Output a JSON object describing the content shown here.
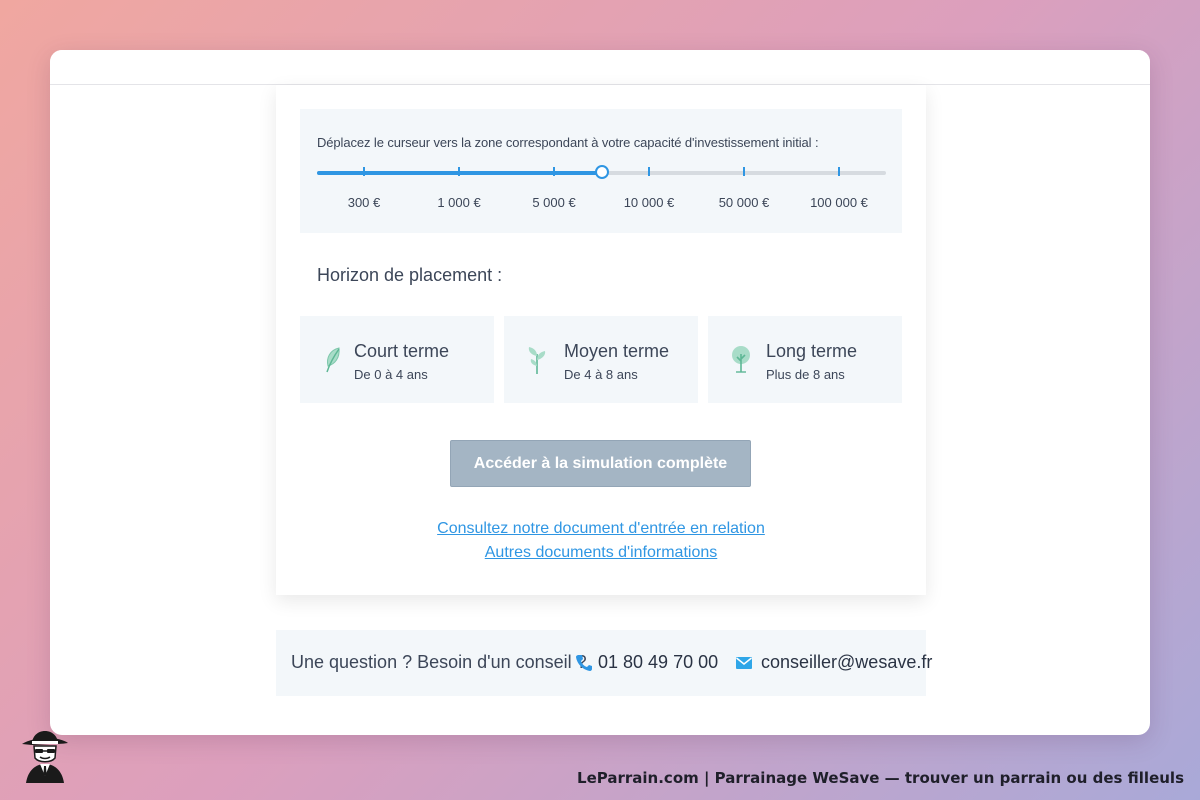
{
  "slider": {
    "instruction": "Déplacez le curseur vers la zone correspondant à votre capacité d'investissement initial :",
    "ticks": [
      "300 €",
      "1 000 €",
      "5 000 €",
      "10 000 €",
      "50 000 €",
      "100 000 €"
    ],
    "value_fraction": 0.5,
    "accent_color": "#2f96e3"
  },
  "horizon": {
    "title": "Horizon de placement :",
    "options": [
      {
        "title": "Court terme",
        "subtitle": "De 0 à 4 ans",
        "icon": "leaf-icon"
      },
      {
        "title": "Moyen terme",
        "subtitle": "De 4 à 8 ans",
        "icon": "sprout-icon"
      },
      {
        "title": "Long terme",
        "subtitle": "Plus de 8 ans",
        "icon": "tree-icon"
      }
    ]
  },
  "cta": {
    "label": "Accéder à la simulation complète",
    "disabled_color": "#a4b5c4"
  },
  "links": {
    "relation_doc": "Consultez notre document d'entrée en relation",
    "other_docs": "Autres documents d'informations"
  },
  "contact": {
    "question": "Une question ? Besoin d'un conseil ?",
    "phone": "01 80 49 70 00",
    "email": "conseiller@wesave.fr",
    "phone_icon": "phone-icon",
    "email_icon": "envelope-icon"
  },
  "footer": {
    "caption": "LeParrain.com | Parrainage WeSave — trouver un parrain ou des filleuls",
    "logo_icon": "detective-icon"
  }
}
